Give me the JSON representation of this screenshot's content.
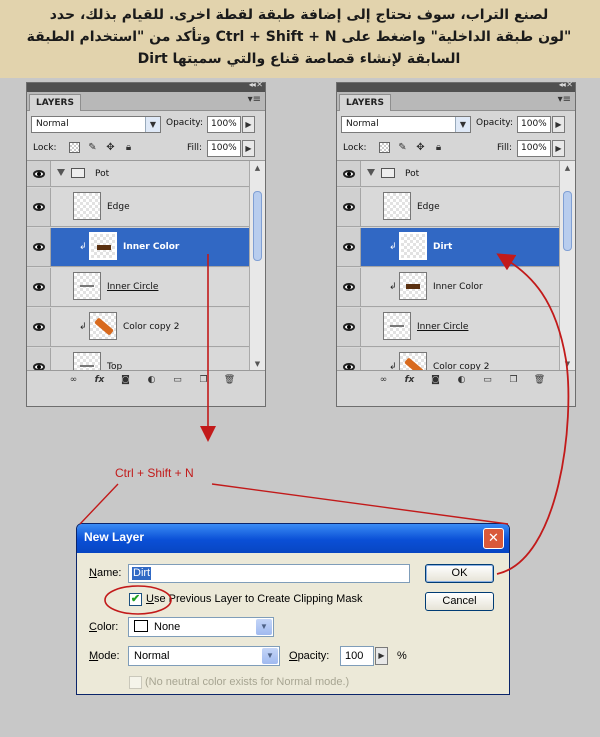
{
  "banner": {
    "lines": [
      "لصنع التراب، سوف نحتاج إلى إضافة طبقة لقطة اخرى. للقيام بذلك، حدد",
      "\"لون طبقة الداخلية\" واضغط على Ctrl + Shift + N وتأكد من \"استخدام الطبقة",
      "السابقة لإنشاء قصاصة قناع والتي سميتها Dirt"
    ]
  },
  "panel_left": {
    "tab": "LAYERS",
    "blend_mode": "Normal",
    "opacity_label": "Opacity:",
    "opacity": "100%",
    "lock_label": "Lock:",
    "fill_label": "Fill:",
    "fill": "100%",
    "layers": [
      {
        "name": "Pot"
      },
      {
        "name": "Edge"
      },
      {
        "name": "Inner Color"
      },
      {
        "name": "Inner Circle"
      },
      {
        "name": "Color copy 2"
      },
      {
        "name": "Top"
      }
    ]
  },
  "panel_right": {
    "tab": "LAYERS",
    "blend_mode": "Normal",
    "opacity_label": "Opacity:",
    "opacity": "100%",
    "lock_label": "Lock:",
    "fill_label": "Fill:",
    "fill": "100%",
    "layers": [
      {
        "name": "Pot"
      },
      {
        "name": "Edge"
      },
      {
        "name": "Dirt"
      },
      {
        "name": "Inner Color"
      },
      {
        "name": "Inner Circle"
      },
      {
        "name": "Color copy 2"
      }
    ]
  },
  "annotation": {
    "shortcut": "Ctrl + Shift + N",
    "color": "#c21a1a"
  },
  "dialog": {
    "title": "New Layer",
    "name_label_u": "N",
    "name_label_rest": "ame:",
    "name_value": "Dirt",
    "clip_label_u": "U",
    "clip_label_rest": "se Previous Layer to Create Clipping Mask",
    "clip_checked": "✔",
    "color_label_u": "C",
    "color_label_rest": "olor:",
    "color_value": "None",
    "mode_label_u": "M",
    "mode_label_rest": "ode:",
    "mode_value": "Normal",
    "opacity_label_u": "O",
    "opacity_label_rest": "pacity:",
    "opacity_value": "100",
    "opacity_unit": "%",
    "neutral_label": "(No neutral color exists for Normal mode.)",
    "ok": "OK",
    "cancel": "Cancel"
  }
}
